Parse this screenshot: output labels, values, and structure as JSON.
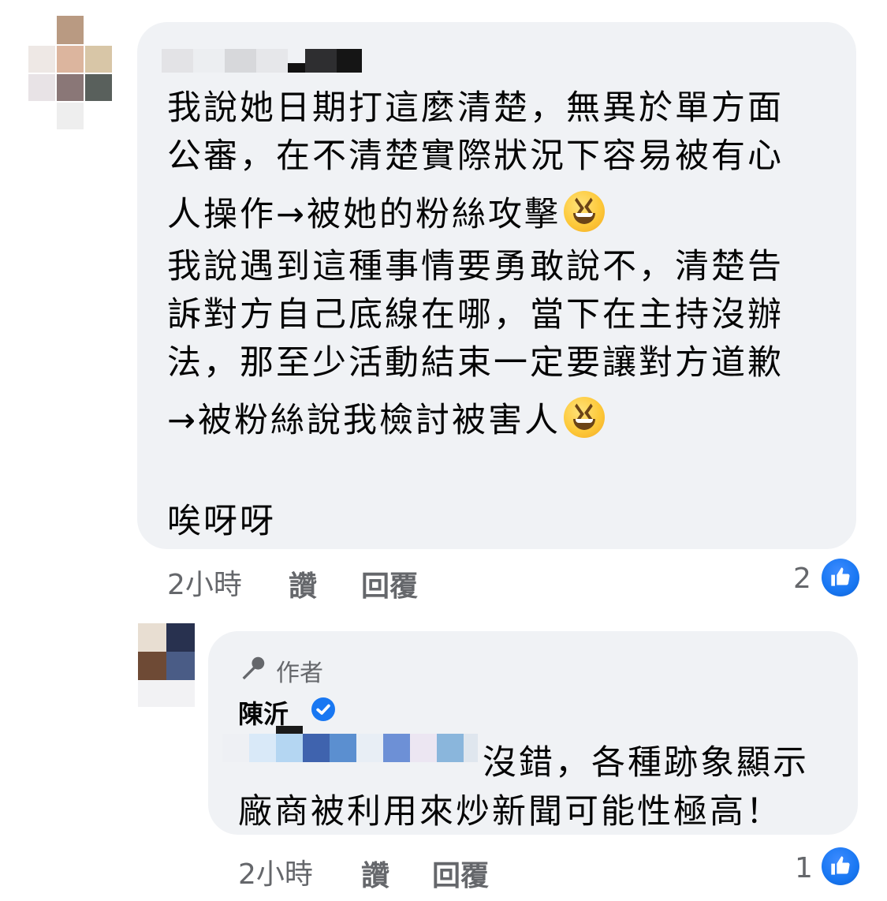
{
  "comment1": {
    "lines": [
      "我說她日期打這麼清楚，無異於單方面",
      "公審，在不清楚實際狀況下容易被有心",
      "人操作→被她的粉絲攻擊",
      "我說遇到這種事情要勇敢說不，清楚告",
      "訴對方自己底線在哪，當下在主持沒辦",
      "法，那至少活動結束一定要讓對方道歉",
      "→被粉絲說我檢討被害人",
      "唉呀呀"
    ],
    "emoji": "laughing-face-emoji",
    "time": "2小時",
    "like_label": "讚",
    "reply_label": "回覆",
    "like_count": "2"
  },
  "comment2": {
    "author_tag": "作者",
    "author_name": "陳沂",
    "line1": "沒錯，各種跡象顯示",
    "line2": "廠商被利用來炒新聞可能性極高！",
    "time": "2小時",
    "like_label": "讚",
    "reply_label": "回覆",
    "like_count": "1"
  },
  "icons": {
    "like": "thumbs-up-icon",
    "author": "microphone-icon",
    "verified": "verified-badge-icon"
  },
  "colors": {
    "bubble": "#f0f2f5",
    "meta_text": "#65676b",
    "like_blue": "#1877f2"
  }
}
